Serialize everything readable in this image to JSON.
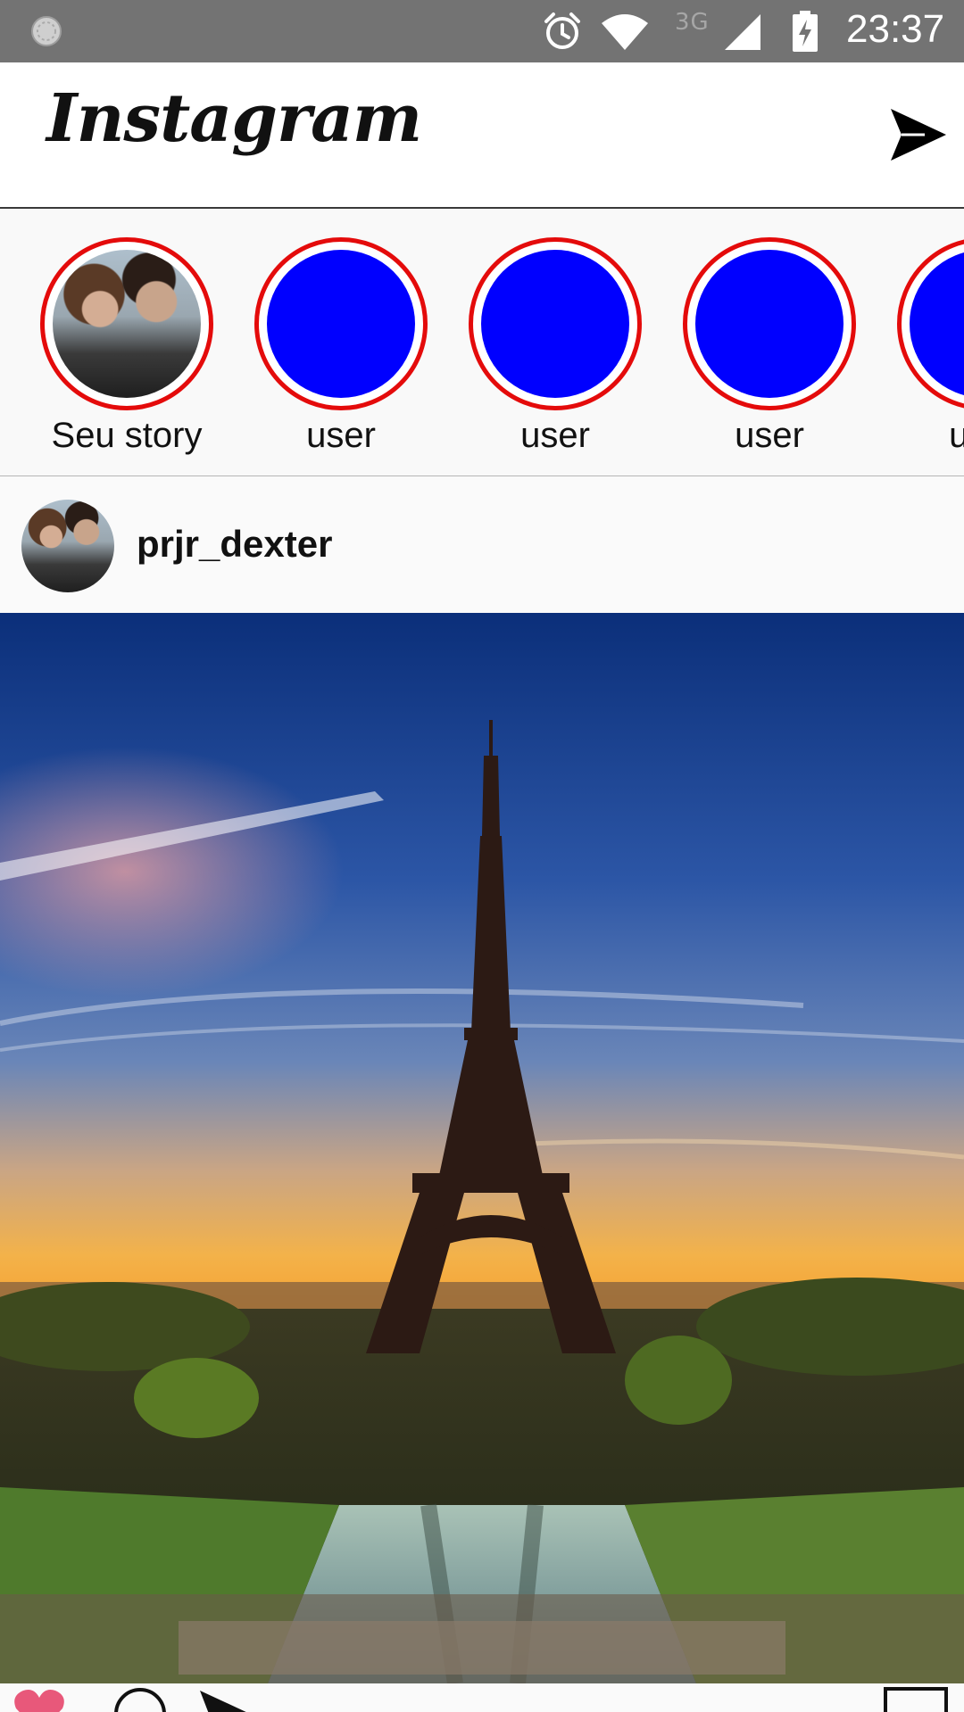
{
  "status_bar": {
    "network_type": "3G",
    "time": "23:37",
    "icons": [
      "notification-icon",
      "alarm-icon",
      "wifi-icon",
      "signal-icon",
      "battery-charging-icon"
    ]
  },
  "header": {
    "logo_text": "Instagram",
    "direct_icon": "send-icon"
  },
  "stories": [
    {
      "label": "Seu story",
      "avatar": "photo"
    },
    {
      "label": "user",
      "avatar_color": "#0000FF"
    },
    {
      "label": "user",
      "avatar_color": "#0000FF"
    },
    {
      "label": "user",
      "avatar_color": "#0000FF"
    },
    {
      "label": "user",
      "avatar_color": "#0000FF"
    }
  ],
  "story_ring_color": "#E40B0B",
  "post": {
    "username": "prjr_dexter",
    "image_icon": "post-photo-eiffel-tower-sunset",
    "actions": [
      "heart-icon",
      "comment-icon",
      "send-icon",
      "bookmark-icon"
    ]
  }
}
